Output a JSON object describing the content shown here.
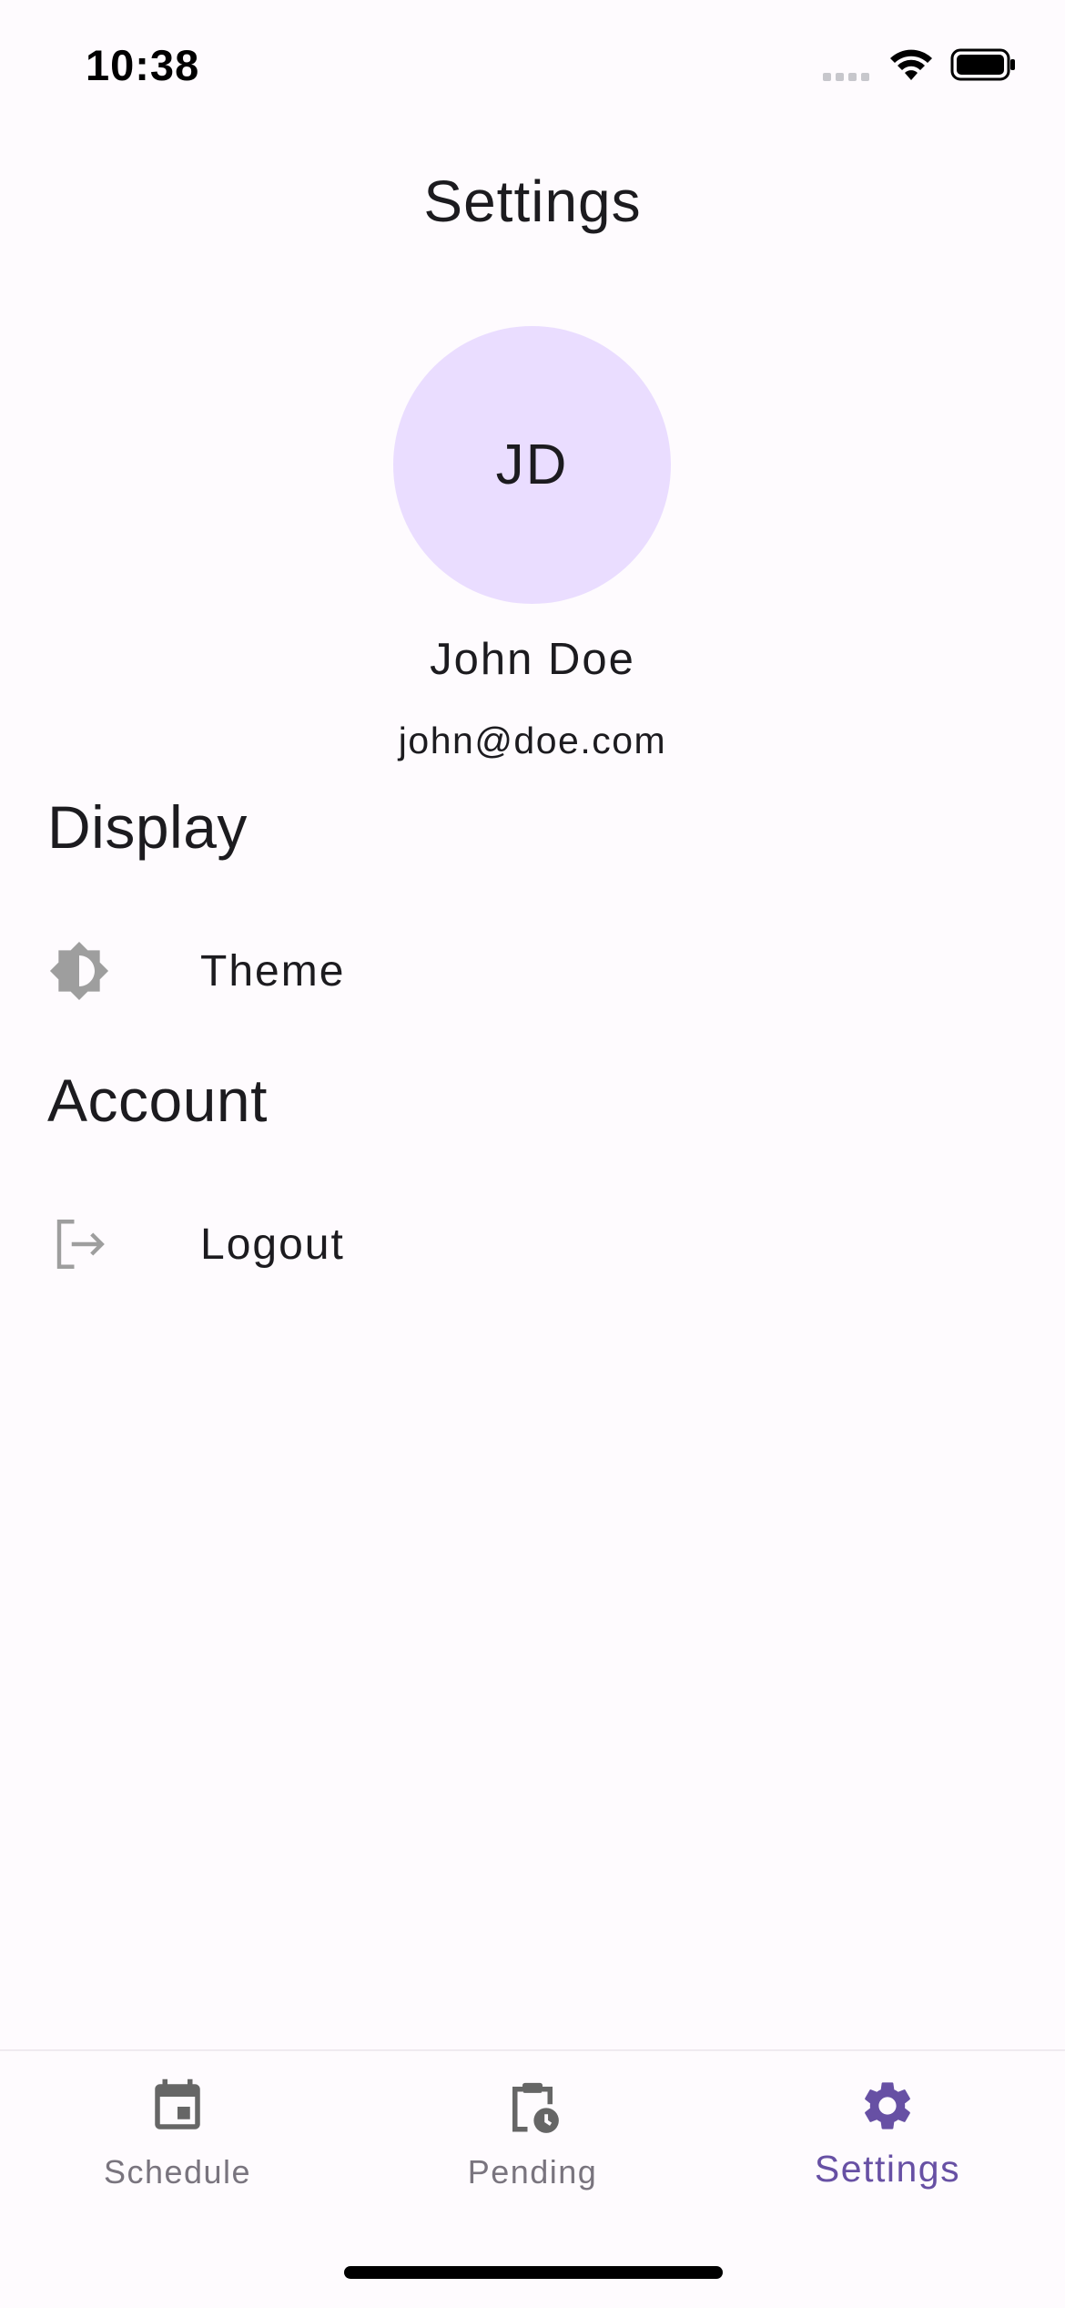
{
  "status_bar": {
    "time": "10:38"
  },
  "header": {
    "title": "Settings"
  },
  "profile": {
    "initials": "JD",
    "name": "John Doe",
    "email": "john@doe.com"
  },
  "sections": [
    {
      "heading": "Display",
      "items": [
        {
          "label": "Theme",
          "icon": "brightness-icon"
        }
      ]
    },
    {
      "heading": "Account",
      "items": [
        {
          "label": "Logout",
          "icon": "logout-icon"
        }
      ]
    }
  ],
  "bottom_nav": {
    "items": [
      {
        "label": "Schedule",
        "icon": "calendar-icon"
      },
      {
        "label": "Pending",
        "icon": "clipboard-clock-icon"
      },
      {
        "label": "Settings",
        "icon": "gear-icon",
        "active": true
      }
    ]
  },
  "colors": {
    "background": "#fefbfe",
    "avatar_background": "#eaddff",
    "accent": "#6750a4",
    "icon_gray": "#9e9e9e",
    "nav_inactive": "#79747e"
  }
}
